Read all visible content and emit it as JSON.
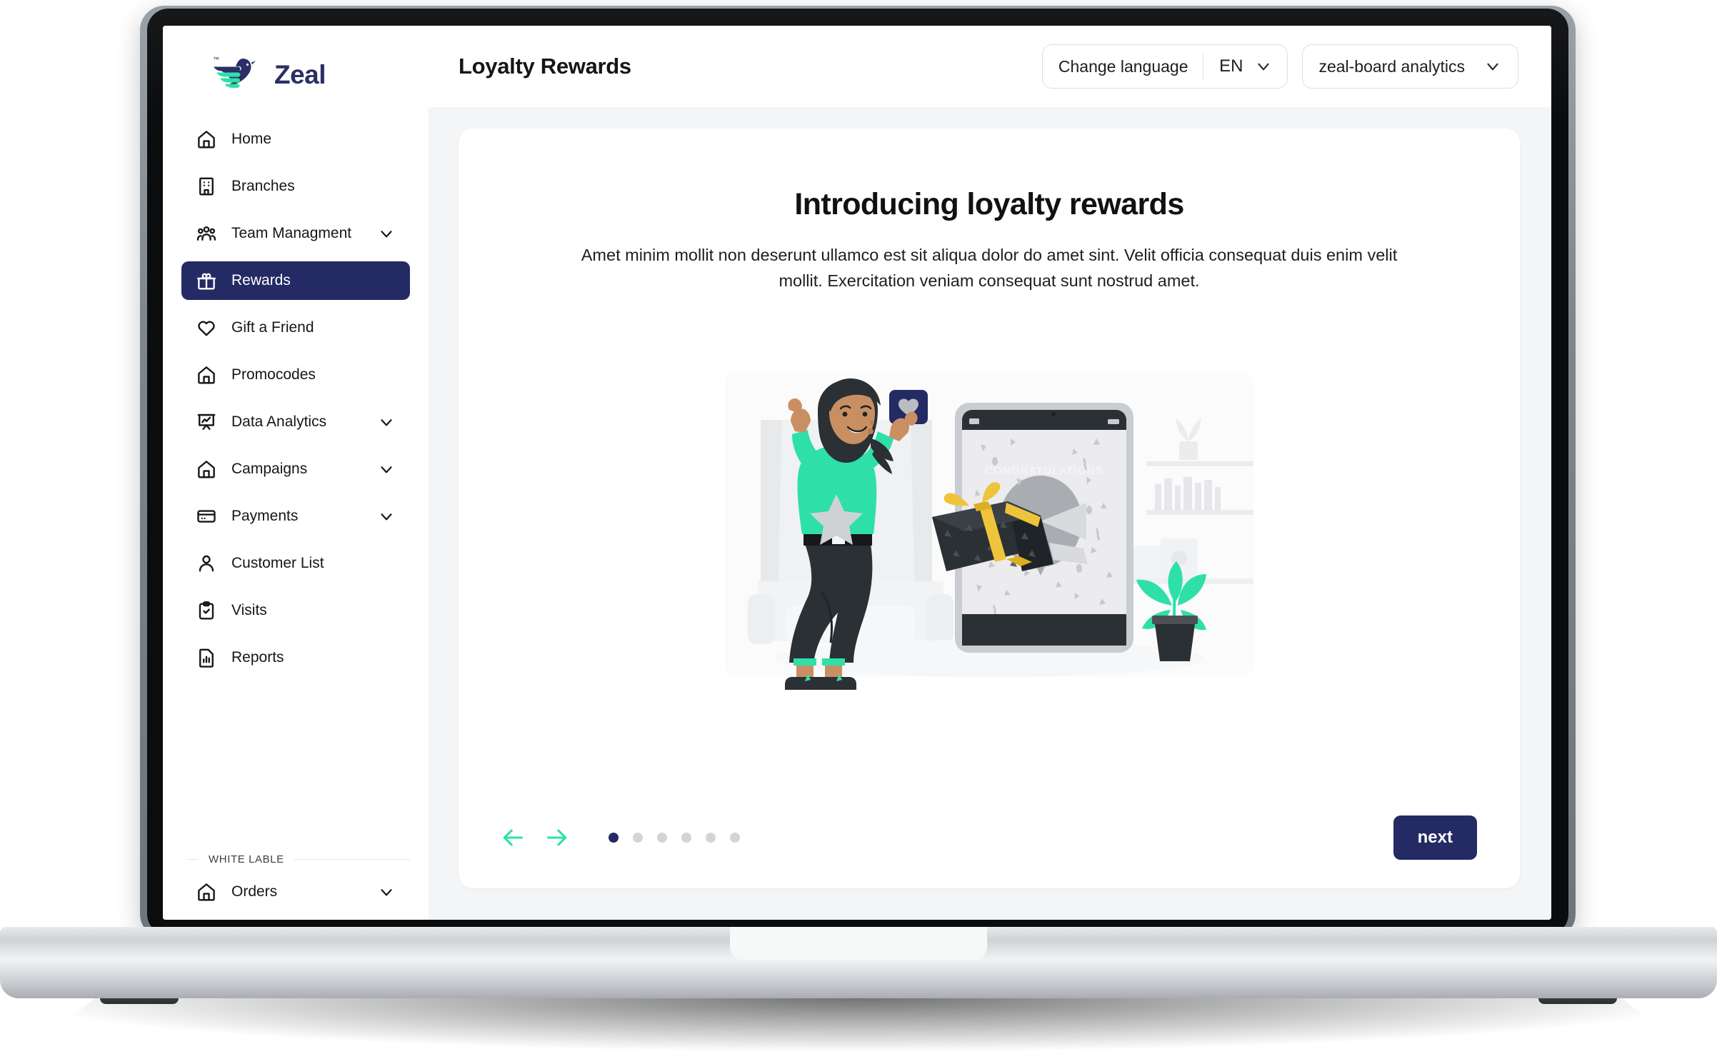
{
  "brand": {
    "name": "Zeal",
    "tm": "™",
    "navy": "#242a63",
    "teal": "#2ee0a8"
  },
  "sidebar": {
    "items": [
      {
        "label": "Home",
        "icon": "home-icon",
        "expandable": false,
        "active": false
      },
      {
        "label": "Branches",
        "icon": "building-icon",
        "expandable": false,
        "active": false
      },
      {
        "label": "Team Managment",
        "icon": "people-icon",
        "expandable": true,
        "active": false
      },
      {
        "label": "Rewards",
        "icon": "gift-icon",
        "expandable": false,
        "active": true
      },
      {
        "label": "Gift a Friend",
        "icon": "heart-icon",
        "expandable": false,
        "active": false
      },
      {
        "label": "Promocodes",
        "icon": "home-icon",
        "expandable": false,
        "active": false
      },
      {
        "label": "Data Analytics",
        "icon": "chart-board-icon",
        "expandable": true,
        "active": false
      },
      {
        "label": "Campaigns",
        "icon": "home-icon",
        "expandable": true,
        "active": false
      },
      {
        "label": "Payments",
        "icon": "card-icon",
        "expandable": true,
        "active": false
      },
      {
        "label": "Customer List",
        "icon": "user-icon",
        "expandable": false,
        "active": false
      },
      {
        "label": "Visits",
        "icon": "clipboard-check-icon",
        "expandable": false,
        "active": false
      },
      {
        "label": "Reports",
        "icon": "report-icon",
        "expandable": false,
        "active": false
      }
    ],
    "section_label": "WHITE LABLE",
    "section_items": [
      {
        "label": "Orders",
        "icon": "home-icon",
        "expandable": true,
        "active": false
      }
    ]
  },
  "topbar": {
    "page_title": "Loyalty Rewards",
    "language_label": "Change language",
    "language_code": "EN",
    "board_label": "zeal-board analytics",
    "chevron_icon": "chevron-down-icon"
  },
  "card": {
    "title": "Introducing loyalty rewards",
    "body": "Amet minim mollit non deserunt ullamco est sit aliqua dolor do amet sint. Velit officia consequat duis enim velit mollit. Exercitation veniam consequat sunt nostrud amet.",
    "illustration": {
      "name": "celebration-reward-illustration",
      "phone_text": "CONGRATULATIONS"
    }
  },
  "footer": {
    "prev_icon": "arrow-left-icon",
    "next_icon": "arrow-right-icon",
    "dots_total": 6,
    "dots_active_index": 0,
    "next_label": "next"
  }
}
